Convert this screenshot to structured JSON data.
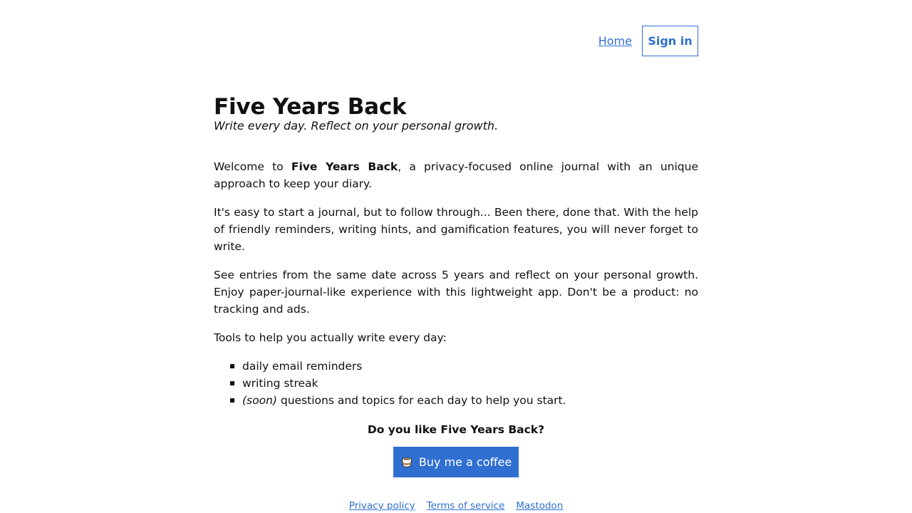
{
  "nav": {
    "home_label": "Home",
    "signin_label": "Sign in"
  },
  "hero": {
    "title": "Five Years Back",
    "tagline": "Write every day. Reflect on your personal growth."
  },
  "intro": {
    "welcome_prefix": "Welcome to ",
    "welcome_brand": "Five Years Back",
    "welcome_suffix": ", a privacy-focused online journal with an unique approach to keep your diary.",
    "paragraph_2": "It's easy to start a journal, but to follow through... Been there, done that. With the help of friendly reminders, writing hints, and gamification features, you will never forget to write.",
    "paragraph_3": "See entries from the same date across 5 years and reflect on your personal growth. Enjoy paper-journal-like experience with this lightweight app. Don't be a product: no tracking and ads.",
    "tools_intro": "Tools to help you actually write every day:"
  },
  "tools": {
    "item_1": "daily email reminders",
    "item_2": "writing streak",
    "item_3_tag": "(soon)",
    "item_3_text": " questions and topics for each day to help you start."
  },
  "support": {
    "question": "Do you like Five Years Back?",
    "button_label": "Buy me a coffee",
    "button_icon": "coffee-cup-icon"
  },
  "footer": {
    "privacy": "Privacy policy",
    "terms": "Terms of service",
    "mastodon": "Mastodon"
  },
  "colors": {
    "accent": "#2f6fd1",
    "text": "#111111",
    "background": "#ffffff"
  }
}
